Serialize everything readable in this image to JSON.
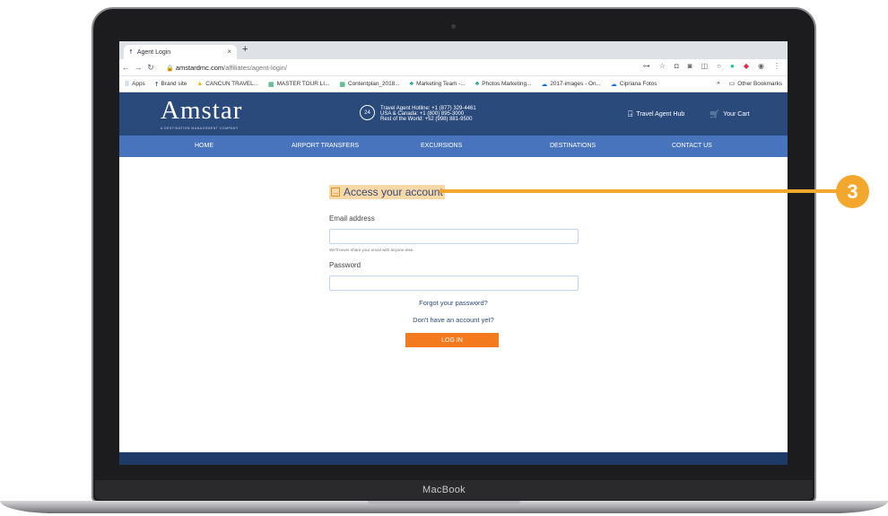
{
  "browser": {
    "tab_title": "Agent Login",
    "tab_close": "×",
    "new_tab": "+",
    "url_host": "amstardmc.com",
    "url_path": "/affiliates/agent-login/",
    "bookmarks": [
      "Apps",
      "Brand site",
      "CANCUN TRAVEL...",
      "MASTER TOUR LI...",
      "Contentplan_2018...",
      "Marketing Team -...",
      "Photos Marketing...",
      "2017-images - On...",
      "Cipriana Fotos"
    ],
    "bookmarks_more": "»",
    "other_bookmarks": "Other Bookmarks"
  },
  "site": {
    "logo": "Amstar",
    "logo_tagline": "A DESTINATION MANAGEMENT COMPANY",
    "hotline_badge": "24",
    "hotline_lines": [
      "Travel Agent Hotline: +1 (877) 329-4461",
      "USA & Canada: +1 (800) 895-3000",
      "Rest of the World: +52 (998) 881-9500"
    ],
    "hub_label": "Travel Agent Hub",
    "cart_label": "Your Cart",
    "nav": [
      "HOME",
      "AIRPORT TRANSFERS",
      "EXCURSIONS",
      "DESTINATIONS",
      "CONTACT US"
    ]
  },
  "form": {
    "title": "Access your account",
    "email_label": "Email address",
    "email_value": "",
    "email_hint": "We'll never share your email with anyone else.",
    "password_label": "Password",
    "password_value": "",
    "forgot_link": "Forgot your password?",
    "signup_link": "Don't have an account yet?",
    "login_button": "LOG IN"
  },
  "annotation": {
    "badge": "3",
    "color": "#f3a72c"
  },
  "device": {
    "label": "MacBook"
  }
}
